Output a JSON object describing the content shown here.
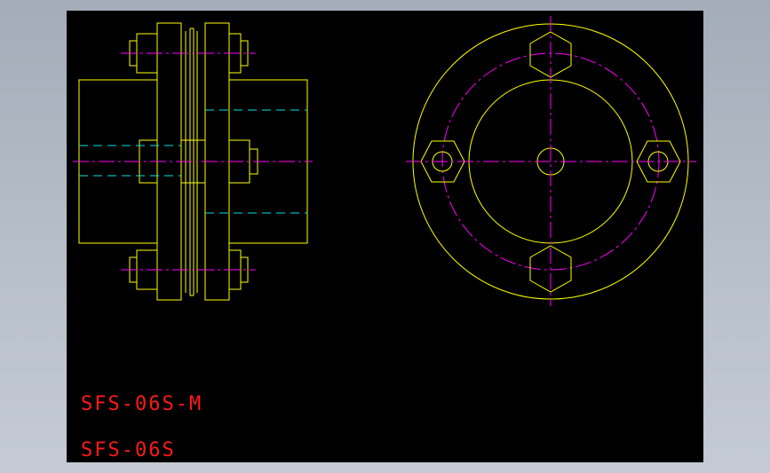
{
  "labels": {
    "part_model_m": "SFS-06S-M",
    "part_model": "SFS-06S"
  },
  "colors": {
    "background": "#000000",
    "geometry": "#ffff00",
    "centerline": "#ff00ff",
    "hidden_line": "#00e5e5",
    "text": "#ff1a1a"
  }
}
